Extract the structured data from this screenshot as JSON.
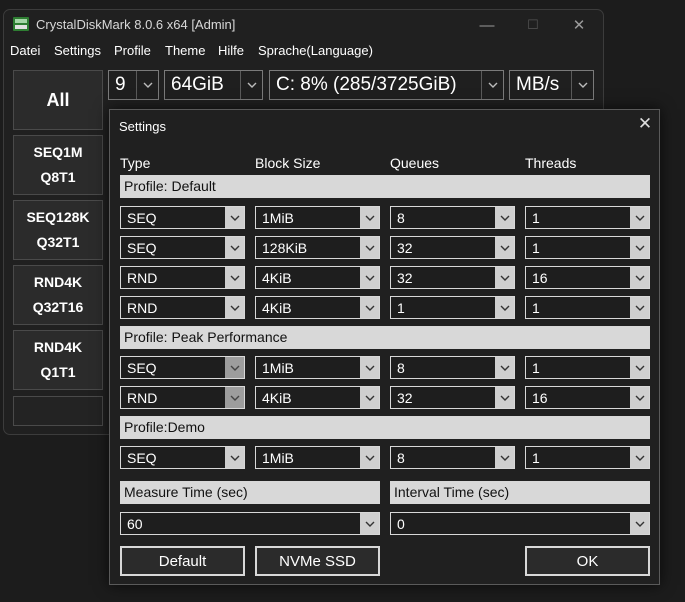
{
  "main": {
    "title": "CrystalDiskMark 8.0.6 x64 [Admin]",
    "minimize": "—",
    "maximize": "☐",
    "close": "✕",
    "menu": [
      "Datei",
      "Settings",
      "Profile",
      "Theme",
      "Hilfe",
      "Sprache(Language)"
    ],
    "all_label": "All",
    "tests": [
      {
        "line1": "SEQ1M",
        "line2": "Q8T1"
      },
      {
        "line1": "SEQ128K",
        "line2": "Q32T1"
      },
      {
        "line1": "RND4K",
        "line2": "Q32T16"
      },
      {
        "line1": "RND4K",
        "line2": "Q1T1"
      }
    ],
    "count": "9",
    "size": "64GiB",
    "drive": "C: 8% (285/3725GiB)",
    "unit": "MB/s"
  },
  "dialog": {
    "title": "Settings",
    "close": "✕",
    "headers": {
      "type": "Type",
      "block_size": "Block Size",
      "queues": "Queues",
      "threads": "Threads"
    },
    "profile_default": {
      "label": "Profile: Default",
      "rows": [
        {
          "type": "SEQ",
          "block": "1MiB",
          "queues": "8",
          "threads": "1"
        },
        {
          "type": "SEQ",
          "block": "128KiB",
          "queues": "32",
          "threads": "1"
        },
        {
          "type": "RND",
          "block": "4KiB",
          "queues": "32",
          "threads": "16"
        },
        {
          "type": "RND",
          "block": "4KiB",
          "queues": "1",
          "threads": "1"
        }
      ]
    },
    "profile_peak": {
      "label": "Profile: Peak Performance",
      "rows": [
        {
          "type": "SEQ",
          "block": "1MiB",
          "queues": "8",
          "threads": "1"
        },
        {
          "type": "RND",
          "block": "4KiB",
          "queues": "32",
          "threads": "16"
        }
      ]
    },
    "profile_demo": {
      "label": "Profile:Demo",
      "rows": [
        {
          "type": "SEQ",
          "block": "1MiB",
          "queues": "8",
          "threads": "1"
        }
      ]
    },
    "measure_time_label": "Measure Time (sec)",
    "measure_time": "60",
    "interval_time_label": "Interval Time (sec)",
    "interval_time": "0",
    "buttons": {
      "default": "Default",
      "nvme": "NVMe SSD",
      "ok": "OK"
    }
  }
}
